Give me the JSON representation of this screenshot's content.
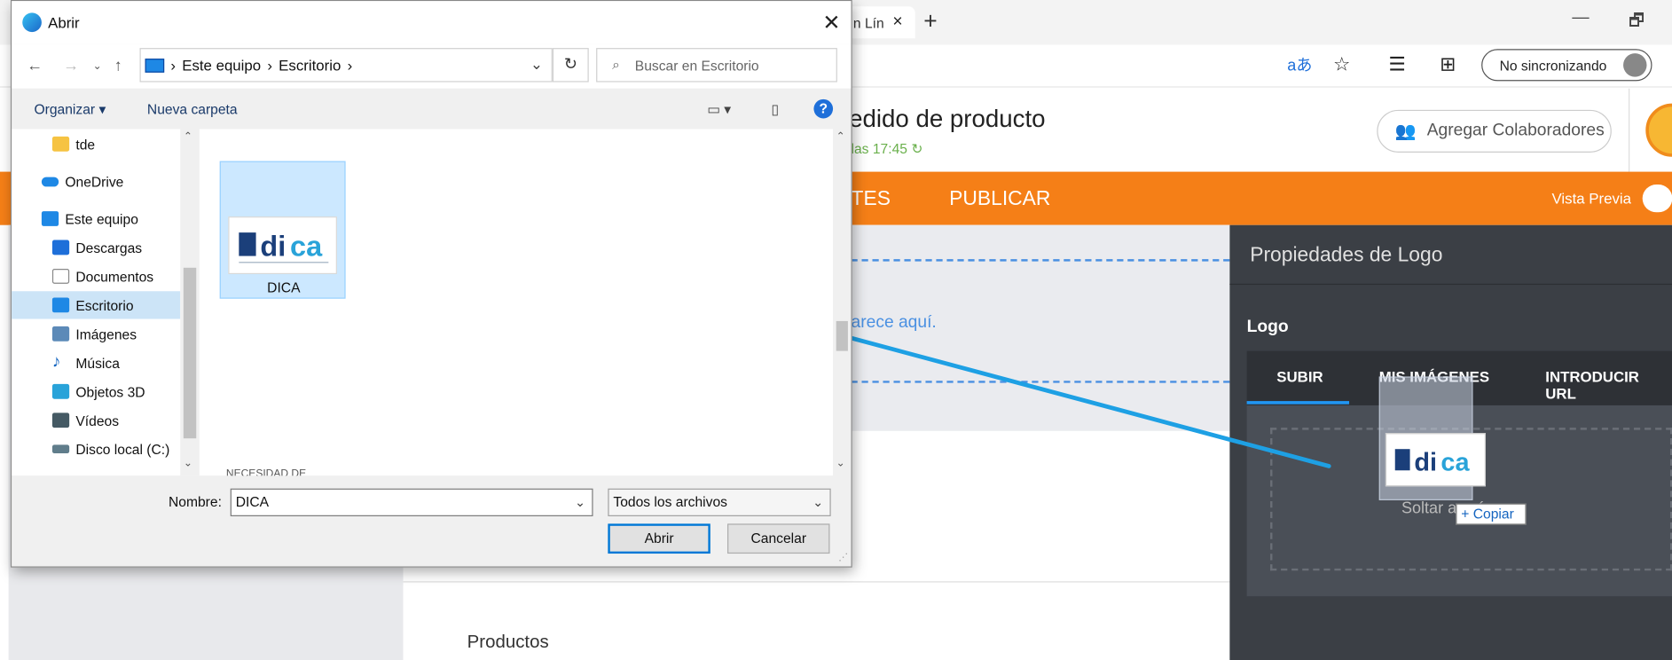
{
  "browser": {
    "tab_label": "n Lín",
    "tab_close": "×",
    "new_tab": "+",
    "minimize": "—",
    "restore": "🗗",
    "sync_label": "No sincronizando"
  },
  "app": {
    "page_title": "edido de producto",
    "saved_status": "las 17:45",
    "collab_button": "Agregar Colaboradores",
    "nav_items": [
      "TES",
      "PUBLICAR"
    ],
    "preview_label": "Vista Previa",
    "placeholder_text": "arece aquí.",
    "section_title": "Productos"
  },
  "panel": {
    "title": "Propiedades de Logo",
    "logo_label": "Logo",
    "tabs": [
      "SUBIR",
      "MIS IMÁGENES",
      "INTRODUCIR URL"
    ],
    "drop_text": "Soltar a         quí",
    "copy_badge": "+ Copiar"
  },
  "dialog": {
    "title": "Abrir",
    "close": "✕",
    "path": [
      "Este equipo",
      "Escritorio"
    ],
    "search_placeholder": "Buscar en Escritorio",
    "organize": "Organizar ▾",
    "new_folder": "Nueva carpeta",
    "help": "?",
    "nav_pane": [
      {
        "label": "tde",
        "icon": "folder-icon",
        "color": "#f6c342"
      },
      {
        "label": "OneDrive",
        "icon": "cloud-icon",
        "color": "#1e88e5"
      },
      {
        "label": "Este equipo",
        "icon": "computer-icon",
        "color": "#1e88e5"
      },
      {
        "label": "Descargas",
        "icon": "download-icon",
        "color": "#1e6fd9"
      },
      {
        "label": "Documentos",
        "icon": "documents-icon",
        "color": "#9e9e9e"
      },
      {
        "label": "Escritorio",
        "icon": "desktop-icon",
        "color": "#1e88e5"
      },
      {
        "label": "Imágenes",
        "icon": "pictures-icon",
        "color": "#5c8ab8"
      },
      {
        "label": "Música",
        "icon": "music-icon",
        "color": "#1565c0"
      },
      {
        "label": "Objetos 3D",
        "icon": "3d-objects-icon",
        "color": "#29a3d9"
      },
      {
        "label": "Vídeos",
        "icon": "videos-icon",
        "color": "#455a64"
      },
      {
        "label": "Disco local (C:)",
        "icon": "drive-icon",
        "color": "#607d8b"
      }
    ],
    "selected_file": "DICA",
    "cut_label_bottom": "NECESIDAD DE",
    "name_label": "Nombre:",
    "name_value": "DICA",
    "file_type": "Todos los archivos",
    "open_button": "Abrir",
    "cancel_button": "Cancelar"
  },
  "colors": {
    "accent_orange": "#f57f17",
    "panel_dark": "#3b3f45",
    "drag_line": "#1ea0e4",
    "selection": "#cce8ff"
  }
}
